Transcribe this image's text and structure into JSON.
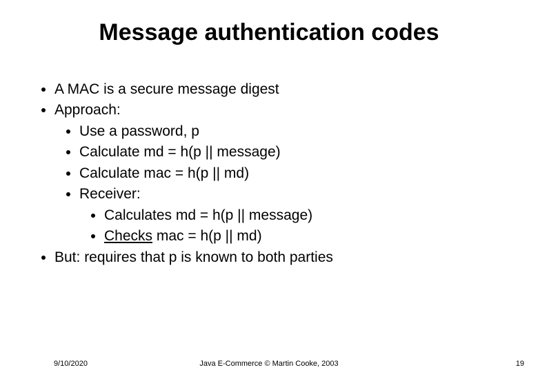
{
  "title": "Message authentication codes",
  "bullets": {
    "b1": "A MAC is a secure message digest",
    "b2": "Approach:",
    "b2_1": "Use a password, p",
    "b2_2": "Calculate md = h(p || message)",
    "b2_3": "Calculate mac = h(p || md)",
    "b2_4": "Receiver:",
    "b2_4_1": "Calculates md = h(p || message)",
    "b2_4_2a": "Checks",
    "b2_4_2b": " mac = h(p || md)",
    "b3": "But: requires that p is known to both parties"
  },
  "footer": {
    "date": "9/10/2020",
    "center": "Java E-Commerce © Martin Cooke, 2003",
    "page": "19"
  }
}
